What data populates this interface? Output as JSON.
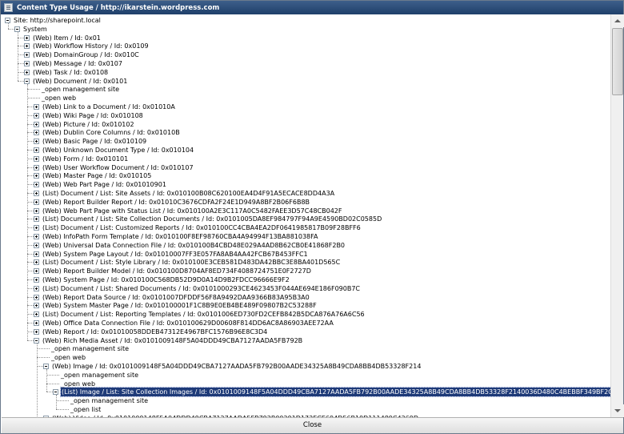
{
  "window": {
    "title": "Content Type Usage / http://ikarstein.wordpress.com",
    "close_label": "Close"
  },
  "tree": [
    {
      "level": 0,
      "label": "Site: http://sharepoint.local",
      "expander": "minus"
    },
    {
      "level": 1,
      "label": "System",
      "expander": "minus"
    },
    {
      "level": 2,
      "label": "(Web) Item / Id: 0x01",
      "expander": "plus"
    },
    {
      "level": 2,
      "label": "(Web) Workflow History / Id: 0x0109",
      "expander": "plus"
    },
    {
      "level": 2,
      "label": "(Web) DomainGroup / Id: 0x010C",
      "expander": "plus"
    },
    {
      "level": 2,
      "label": "(Web) Message / Id: 0x0107",
      "expander": "plus"
    },
    {
      "level": 2,
      "label": "(Web) Task / Id: 0x0108",
      "expander": "plus"
    },
    {
      "level": 2,
      "label": "(Web) Document / Id: 0x0101",
      "expander": "minus"
    },
    {
      "level": 3,
      "label": "_open management site",
      "expander": "none"
    },
    {
      "level": 3,
      "label": "_open web",
      "expander": "none"
    },
    {
      "level": 3,
      "label": "(Web) Link to a Document / Id: 0x01010A",
      "expander": "plus"
    },
    {
      "level": 3,
      "label": "(Web) Wiki Page / Id: 0x010108",
      "expander": "plus"
    },
    {
      "level": 3,
      "label": "(Web) Picture / Id: 0x010102",
      "expander": "plus"
    },
    {
      "level": 3,
      "label": "(Web) Dublin Core Columns / Id: 0x01010B",
      "expander": "plus"
    },
    {
      "level": 3,
      "label": "(Web) Basic Page / Id: 0x010109",
      "expander": "plus"
    },
    {
      "level": 3,
      "label": "(Web) Unknown Document Type / Id: 0x010104",
      "expander": "plus"
    },
    {
      "level": 3,
      "label": "(Web) Form / Id: 0x010101",
      "expander": "plus"
    },
    {
      "level": 3,
      "label": "(Web) User Workflow Document / Id: 0x010107",
      "expander": "plus"
    },
    {
      "level": 3,
      "label": "(Web) Master Page / Id: 0x010105",
      "expander": "plus"
    },
    {
      "level": 3,
      "label": "(Web) Web Part Page / Id: 0x01010901",
      "expander": "plus"
    },
    {
      "level": 3,
      "label": "(List) Document / List: Site Assets / Id: 0x010100B08C620100EA4D4F91A5ECACE8DD4A3A",
      "expander": "plus"
    },
    {
      "level": 3,
      "label": "(Web) Report Builder Report / Id: 0x01010C3676CDFA2F24E1D949A8BF2B06F6B8B",
      "expander": "plus"
    },
    {
      "level": 3,
      "label": "(Web) Web Part Page with Status List / Id: 0x010100A2E3C117A0C5482FAEE3D57C48CB042F",
      "expander": "plus"
    },
    {
      "level": 3,
      "label": "(List) Document / List: Site Collection Documents / Id: 0x0101005DA8EF984797F94A9E4590BD02C0585D",
      "expander": "plus"
    },
    {
      "level": 3,
      "label": "(List) Document / List: Customized Reports / Id: 0x010100CC4CBA4EA2DF0641985817B09F28BFF6",
      "expander": "plus"
    },
    {
      "level": 3,
      "label": "(Web) InfoPath Form Template / Id: 0x010100F8EF98760CBA4A94994F13BA881038FA",
      "expander": "plus"
    },
    {
      "level": 3,
      "label": "(Web) Universal Data Connection File / Id: 0x010100B4CBD48E029A4AD8B62CB0E41868F2B0",
      "expander": "plus"
    },
    {
      "level": 3,
      "label": "(Web) System Page Layout / Id: 0x01010007FF3E057FA8AB4AA42FCB67B453FFC1",
      "expander": "plus"
    },
    {
      "level": 3,
      "label": "(List) Document / List: Style Library / Id: 0x010100E3CEB581D483DA42BBC3E8BA401D565C",
      "expander": "plus"
    },
    {
      "level": 3,
      "label": "(Web) Report Builder Model / Id: 0x010100D8704AF8ED734F4088724751E0F2727D",
      "expander": "plus"
    },
    {
      "level": 3,
      "label": "(Web) System Page / Id: 0x010100C568DB52D9D0A14D9B2FDCC96666E9F2",
      "expander": "plus"
    },
    {
      "level": 3,
      "label": "(List) Document / List: Shared Documents / Id: 0x0101000293CE4623453F044AE694E186F090B7C",
      "expander": "plus"
    },
    {
      "level": 3,
      "label": "(Web) Report Data Source / Id: 0x0101007DFDDF56F8A9492DAA9366B83A95B3A0",
      "expander": "plus"
    },
    {
      "level": 3,
      "label": "(Web) System Master Page / Id: 0x010100001F1C8B9E0EB4BE489F09807B2C53288F",
      "expander": "plus"
    },
    {
      "level": 3,
      "label": "(List) Document / List: Reporting Templates / Id: 0x0101006ED730FD2CEFB842B5DCA876A76A6C56",
      "expander": "plus"
    },
    {
      "level": 3,
      "label": "(Web) Office Data Connection File / Id: 0x010100629D00608F814DD6AC8A86903AEE72AA",
      "expander": "plus"
    },
    {
      "level": 3,
      "label": "(Web) Report / Id: 0x01010058DDEB47312E4967BFC1576B96E8C3D4",
      "expander": "plus"
    },
    {
      "level": 3,
      "label": "(Web) Rich Media Asset / Id: 0x0101009148F5A04DDD49CBA7127AADA5FB792B",
      "expander": "minus"
    },
    {
      "level": 4,
      "label": "_open management site",
      "expander": "none"
    },
    {
      "level": 4,
      "label": "_open web",
      "expander": "none"
    },
    {
      "level": 4,
      "label": "(Web) Image / Id: 0x0101009148F5A04DDD49CBA7127AADA5FB792B00AADE34325A8B49CDA8BB4DB53328F214",
      "expander": "minus"
    },
    {
      "level": 5,
      "label": "_open management site",
      "expander": "none"
    },
    {
      "level": 5,
      "label": "_open web",
      "expander": "none"
    },
    {
      "level": 5,
      "label": "(List) Image / List: Site Collection Images / Id: 0x0101009148F5A04DDD49CBA7127AADA5FB792B00AADE34325A8B49CDA8BB4DB53328F2140036D480C4BEBBF349BF2C6FFE6ED0CEF4",
      "expander": "minus",
      "selected": true
    },
    {
      "level": 6,
      "label": "_open management site",
      "expander": "none"
    },
    {
      "level": 6,
      "label": "_open list",
      "expander": "none"
    },
    {
      "level": 4,
      "label": "(Web) Video / Id: 0x0101009148F5A04DDD49CBA7127AADA5FB792B00291D173ECE694D56B19D111489C4369D",
      "expander": "plus"
    }
  ]
}
